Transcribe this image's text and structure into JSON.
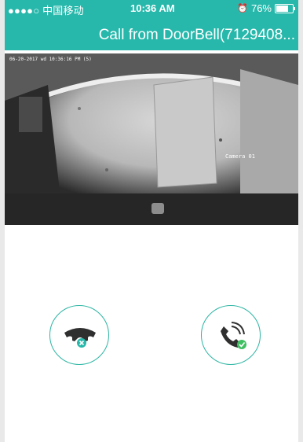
{
  "status_bar": {
    "carrier": "●●●●○ 中国移动",
    "time": "10:36 AM",
    "battery": "76%"
  },
  "header": {
    "title": "Call from DoorBell(7129408..."
  },
  "video": {
    "timestamp": "06-20-2017 wd 10:36:16 PM (5)",
    "camera_label": "Camera 01"
  },
  "actions": {
    "decline": "decline-call",
    "accept": "accept-call"
  },
  "colors": {
    "accent": "#27b8ab",
    "decline_badge": "#27b8ab",
    "accept_badge": "#3fbf62"
  }
}
